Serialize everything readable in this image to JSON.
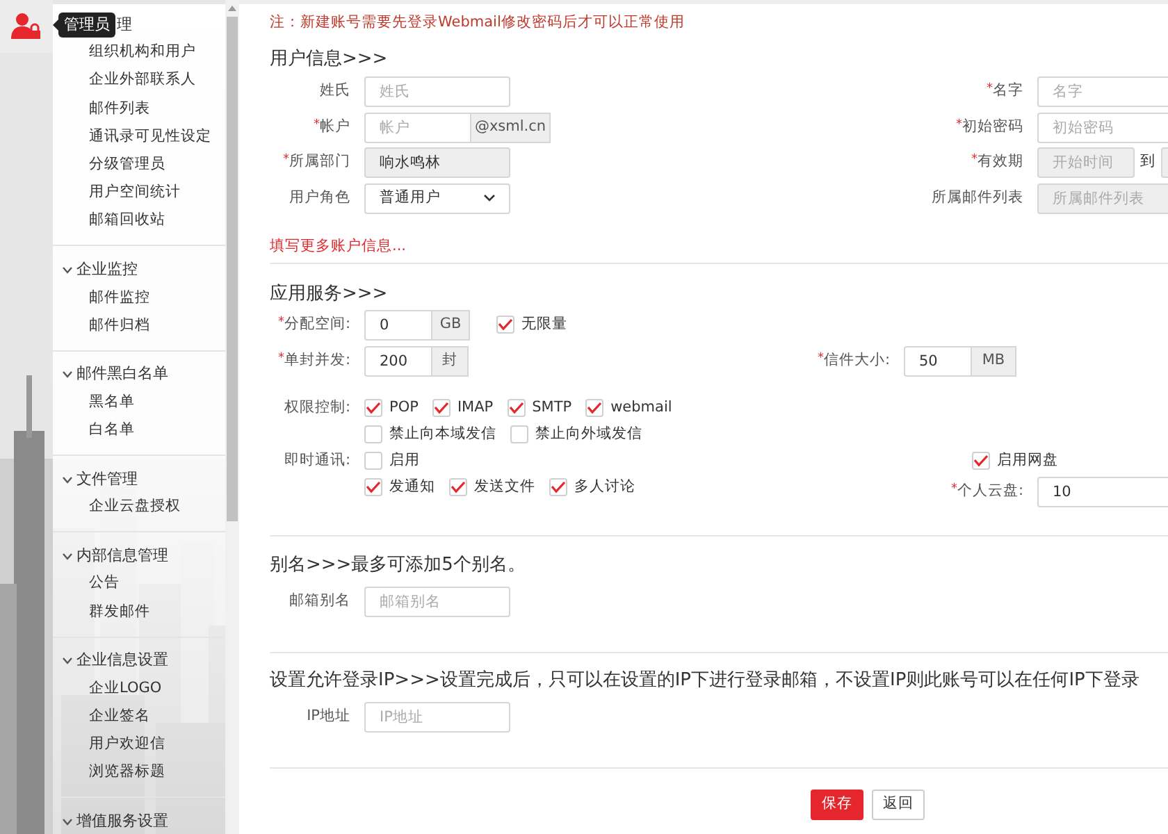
{
  "sidebar": {
    "groups": [
      {
        "tooltip": "管理员",
        "title": "理",
        "expanded": true,
        "items": [
          "组织机构和用户",
          "企业外部联系人",
          "邮件列表",
          "通讯录可见性设定",
          "分级管理员",
          "用户空间统计",
          "邮箱回收站"
        ]
      },
      {
        "title": "企业监控",
        "expanded": true,
        "items": [
          "邮件监控",
          "邮件归档"
        ]
      },
      {
        "title": "邮件黑白名单",
        "expanded": true,
        "items": [
          "黑名单",
          "白名单"
        ]
      },
      {
        "title": "文件管理",
        "expanded": true,
        "items": [
          "企业云盘授权"
        ]
      },
      {
        "title": "内部信息管理",
        "expanded": true,
        "items": [
          "公告",
          "群发邮件"
        ]
      },
      {
        "title": "企业信息设置",
        "expanded": true,
        "items": [
          "企业LOGO",
          "企业签名",
          "用户欢迎信",
          "浏览器标题"
        ]
      },
      {
        "title": "增值服务设置",
        "expanded": true
      }
    ]
  },
  "notice": "注：新建账号需要先登录Webmail修改密码后才可以正常使用",
  "user_info": {
    "title": "用户信息>>>",
    "rows": [
      {
        "left": {
          "label": "姓氏",
          "placeholder": "姓氏"
        },
        "right": {
          "mark": "*",
          "label": "名字",
          "placeholder": "名字"
        }
      },
      {
        "left": {
          "mark": "*",
          "label": "帐户",
          "placeholder": "帐户",
          "suffix": "@xsml.cn"
        },
        "right": {
          "mark": "*",
          "label": "初始密码",
          "placeholder": "初始密码"
        }
      },
      {
        "left": {
          "mark": "*",
          "label": "所属部门",
          "value": "响水鸣林",
          "disabled": true
        },
        "right": {
          "mark": "*",
          "label": "有效期",
          "kind": "range",
          "placeholder": "开始时间",
          "disabled": true,
          "separator": "到"
        }
      },
      {
        "left": {
          "label": "用户角色",
          "kind": "select",
          "value": "普通用户"
        },
        "right": {
          "label": "所属邮件列表",
          "placeholder": "所属邮件列表",
          "disabled": true
        }
      }
    ],
    "more_link": "填写更多账户信息..."
  },
  "app_services": {
    "title": "应用服务>>>",
    "quota": {
      "mark": "*",
      "label": "分配空间:",
      "value": "0",
      "unit": "GB"
    },
    "unlimited": {
      "label": "无限量",
      "checked": true
    },
    "per_send": {
      "mark": "*",
      "label": "单封并发:",
      "value": "200",
      "unit": "封"
    },
    "mail_size": {
      "mark": "*",
      "label": "信件大小:",
      "value": "50",
      "unit": "MB"
    },
    "permissions": {
      "label": "权限控制:",
      "protocols": [
        {
          "label": "POP",
          "checked": true
        },
        {
          "label": "IMAP",
          "checked": true
        },
        {
          "label": "SMTP",
          "checked": true
        },
        {
          "label": "webmail",
          "checked": true
        }
      ],
      "sending": [
        {
          "label": "禁止向本域发信",
          "checked": false
        },
        {
          "label": "禁止向外域发信",
          "checked": false
        }
      ]
    },
    "instant_messaging": {
      "label": "即时通讯:",
      "enable": {
        "label": "启用",
        "checked": false
      },
      "features": [
        {
          "label": "发通知",
          "checked": true
        },
        {
          "label": "发送文件",
          "checked": true
        },
        {
          "label": "多人讨论",
          "checked": true
        }
      ]
    },
    "netdisk": {
      "label": "启用网盘",
      "checked": true
    },
    "personal_disk": {
      "mark": "*",
      "label": "个人云盘:",
      "value": "10"
    }
  },
  "alias": {
    "title": "别名>>>最多可添加5个别名。",
    "label": "邮箱别名",
    "placeholder": "邮箱别名"
  },
  "ip": {
    "title": "设置允许登录IP>>>设置完成后，只可以在设置的IP下进行登录邮箱，不设置IP则此账号可以在任何IP下登录",
    "label": "IP地址",
    "placeholder": "IP地址"
  },
  "buttons": [
    {
      "label": "保存",
      "kind": "primary"
    },
    {
      "label": "返回",
      "kind": "default"
    }
  ]
}
